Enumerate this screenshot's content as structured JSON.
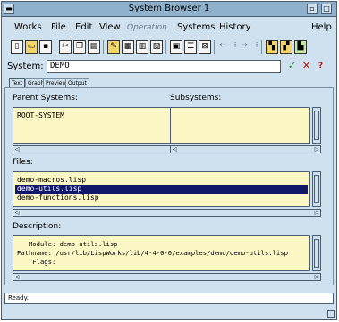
{
  "window": {
    "title": "System Browser 1"
  },
  "menu": {
    "works": "Works",
    "file": "File",
    "edit": "Edit",
    "view": "View",
    "operation": "Operation",
    "systems": "Systems",
    "history": "History",
    "help": "Help"
  },
  "toolbar": {
    "icons": [
      "new-file-icon",
      "open-file-icon",
      "save-file-icon",
      "cut-icon",
      "copy-icon",
      "paste-icon",
      "tool-a-icon",
      "tool-b-icon",
      "tool-c-icon",
      "tool-d-icon",
      "tool-e-icon",
      "tool-f-icon",
      "back-icon",
      "history-icon",
      "forward-icon",
      "history-forward-icon",
      "system-a-icon",
      "system-b-icon",
      "system-c-icon"
    ]
  },
  "system": {
    "label": "System:",
    "value": "DEMO"
  },
  "actions": {
    "ok": "✓",
    "cancel": "✕",
    "help": "?"
  },
  "tabs": [
    "Text",
    "Graph",
    "Preview",
    "Output"
  ],
  "parent": {
    "label": "Parent Systems:",
    "items": [
      "ROOT-SYSTEM"
    ]
  },
  "subsystems": {
    "label": "Subsystems:",
    "items": []
  },
  "files": {
    "label": "Files:",
    "items": [
      "demo-macros.lisp",
      "demo-utils.lisp",
      "demo-functions.lisp"
    ],
    "selected_index": 1
  },
  "description": {
    "label": "Description:",
    "lines": [
      "   Module: demo-utils.lisp",
      "Pathname: /usr/lib/LispWorks/lib/4-4-0-0/examples/demo/demo-utils.lisp",
      "    Flags:"
    ]
  },
  "status": {
    "text": "Ready."
  },
  "colors": {
    "window_bg": "#cfe0ee",
    "list_bg": "#fbf7c4",
    "selection": "#10186a"
  }
}
